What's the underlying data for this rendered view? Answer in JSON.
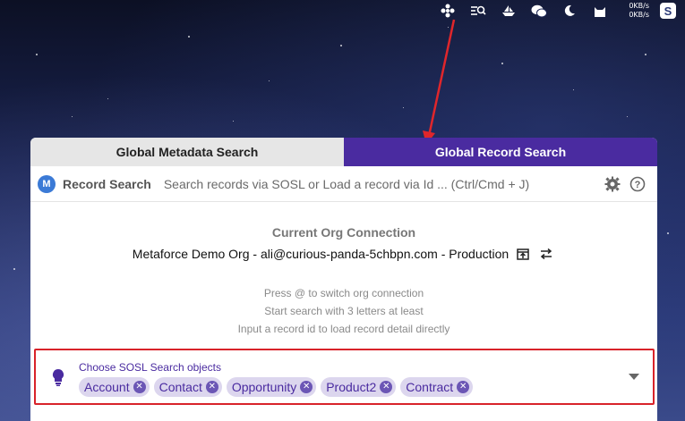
{
  "menubar": {
    "icons": [
      "pinwheel-icon",
      "record-search-icon",
      "boat-icon",
      "wechat-icon",
      "moon-icon",
      "cat-icon"
    ],
    "net_up": "0KB/s",
    "net_down": "0KB/s",
    "app_letter": "S"
  },
  "tabs": {
    "metadata": "Global Metadata Search",
    "record": "Global Record Search"
  },
  "search": {
    "logo_letter": "M",
    "label": "Record Search",
    "placeholder": "Search records via SOSL or Load a record via Id ... (Ctrl/Cmd + J)"
  },
  "org": {
    "title": "Current Org Connection",
    "connection": "Metaforce Demo Org - ali@curious-panda-5chbpn.com - Production"
  },
  "hints": [
    "Press @ to switch org connection",
    "Start search with 3 letters at least",
    "Input a record id to load record detail directly"
  ],
  "sosl": {
    "label": "Choose SOSL Search objects",
    "objects": [
      "Account",
      "Contact",
      "Opportunity",
      "Product2",
      "Contract"
    ]
  },
  "colors": {
    "accent": "#4a2ba0",
    "highlight": "#d8232a",
    "arrow": "#e0262b"
  }
}
